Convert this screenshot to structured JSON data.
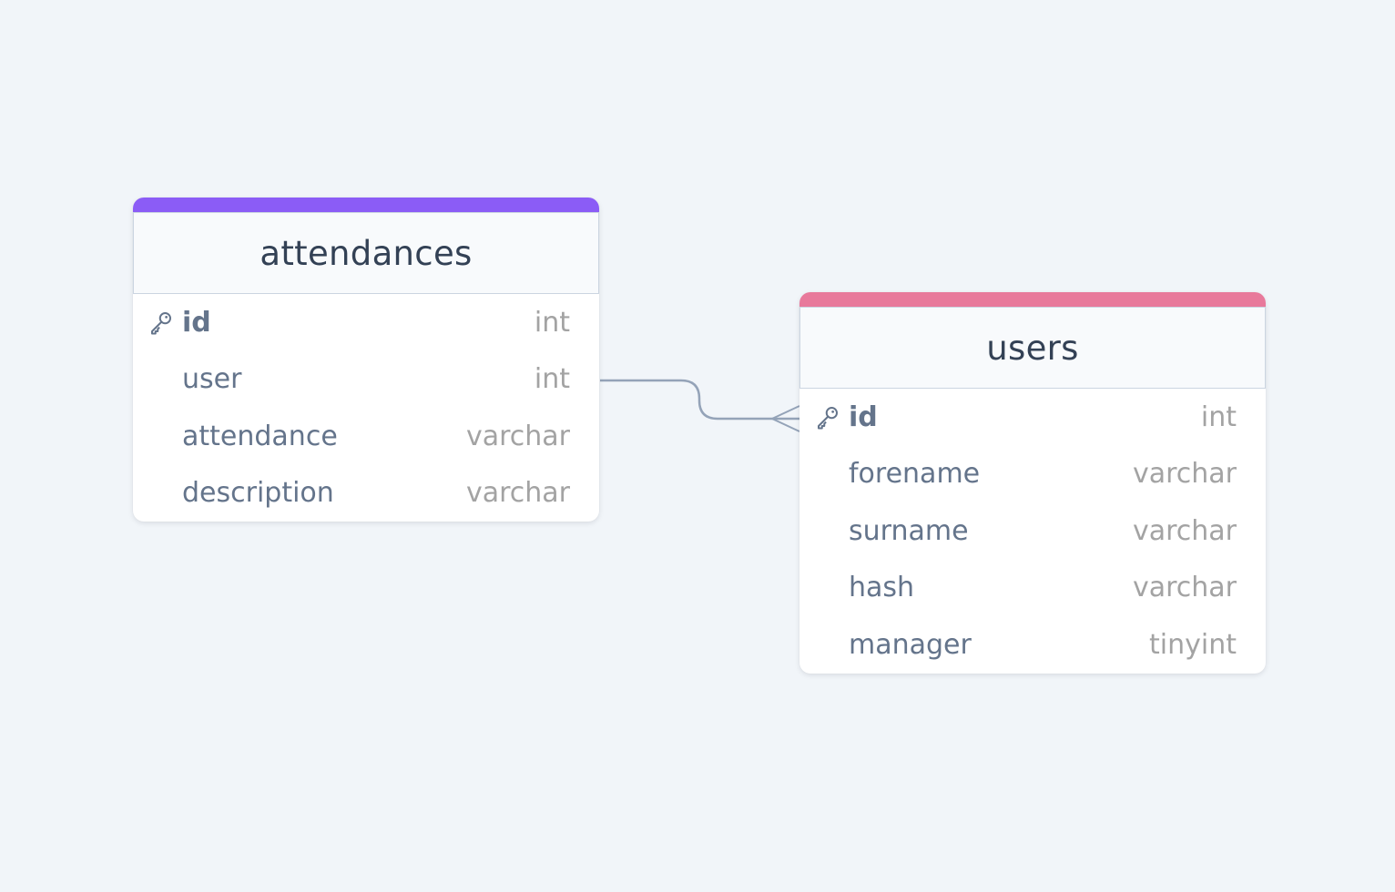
{
  "tables": {
    "attendances": {
      "name": "attendances",
      "accent_color": "#8b5cf6",
      "fields": [
        {
          "name": "id",
          "type": "int",
          "primary_key": true
        },
        {
          "name": "user",
          "type": "int",
          "primary_key": false
        },
        {
          "name": "attendance",
          "type": "varchar",
          "primary_key": false
        },
        {
          "name": "description",
          "type": "varchar",
          "primary_key": false
        }
      ]
    },
    "users": {
      "name": "users",
      "accent_color": "#e8799b",
      "fields": [
        {
          "name": "id",
          "type": "int",
          "primary_key": true
        },
        {
          "name": "forename",
          "type": "varchar",
          "primary_key": false
        },
        {
          "name": "surname",
          "type": "varchar",
          "primary_key": false
        },
        {
          "name": "hash",
          "type": "varchar",
          "primary_key": false
        },
        {
          "name": "manager",
          "type": "tinyint",
          "primary_key": false
        }
      ]
    }
  },
  "relationship": {
    "from": "attendances.user",
    "to": "users.id",
    "from_cardinality": "one",
    "to_cardinality": "many",
    "line_color": "#94a3b8"
  },
  "icons": {
    "primary_key": "key-icon"
  }
}
